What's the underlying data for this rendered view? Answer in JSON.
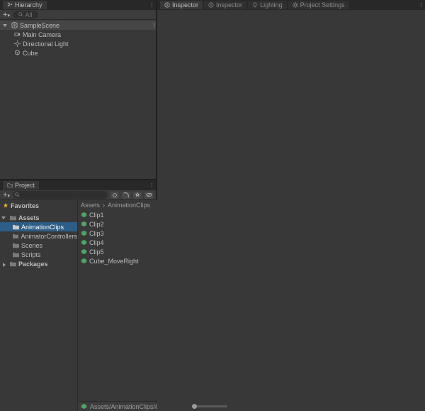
{
  "hierarchy": {
    "tab_label": "Hierarchy",
    "search_placeholder": "All",
    "scene_name": "SampleScene",
    "objects": [
      "Main Camera",
      "Directional Light",
      "Cube"
    ]
  },
  "project": {
    "tab_label": "Project",
    "favorites_label": "Favorites",
    "assets_label": "Assets",
    "packages_label": "Packages",
    "asset_folders": [
      "AnimationClips",
      "AnimatorControllers",
      "Scenes",
      "Scripts"
    ],
    "selected_folder": "AnimationClips",
    "breadcrumb_root": "Assets",
    "breadcrumb_current": "AnimationClips",
    "clips": [
      "Clip1",
      "Clip2",
      "Clip3",
      "Clip4",
      "Clip5",
      "Cube_MoveRight"
    ],
    "status_path": "Assets/AnimationClips/Cube_"
  },
  "inspector": {
    "tabs": [
      "Inspector",
      "Inspector",
      "Lighting",
      "Project Settings"
    ]
  },
  "icons": {
    "hierarchy": "hierarchy-icon",
    "inspector": "info-icon",
    "lighting": "lightbulb-icon",
    "settings": "gear-icon",
    "plus": "+",
    "search": "search-icon",
    "star": "star-icon",
    "folder": "folder-icon",
    "anim": "animation-clip-icon",
    "camera": "camera-icon",
    "light": "light-icon",
    "cube": "cube-icon",
    "unity": "unity-icon"
  }
}
